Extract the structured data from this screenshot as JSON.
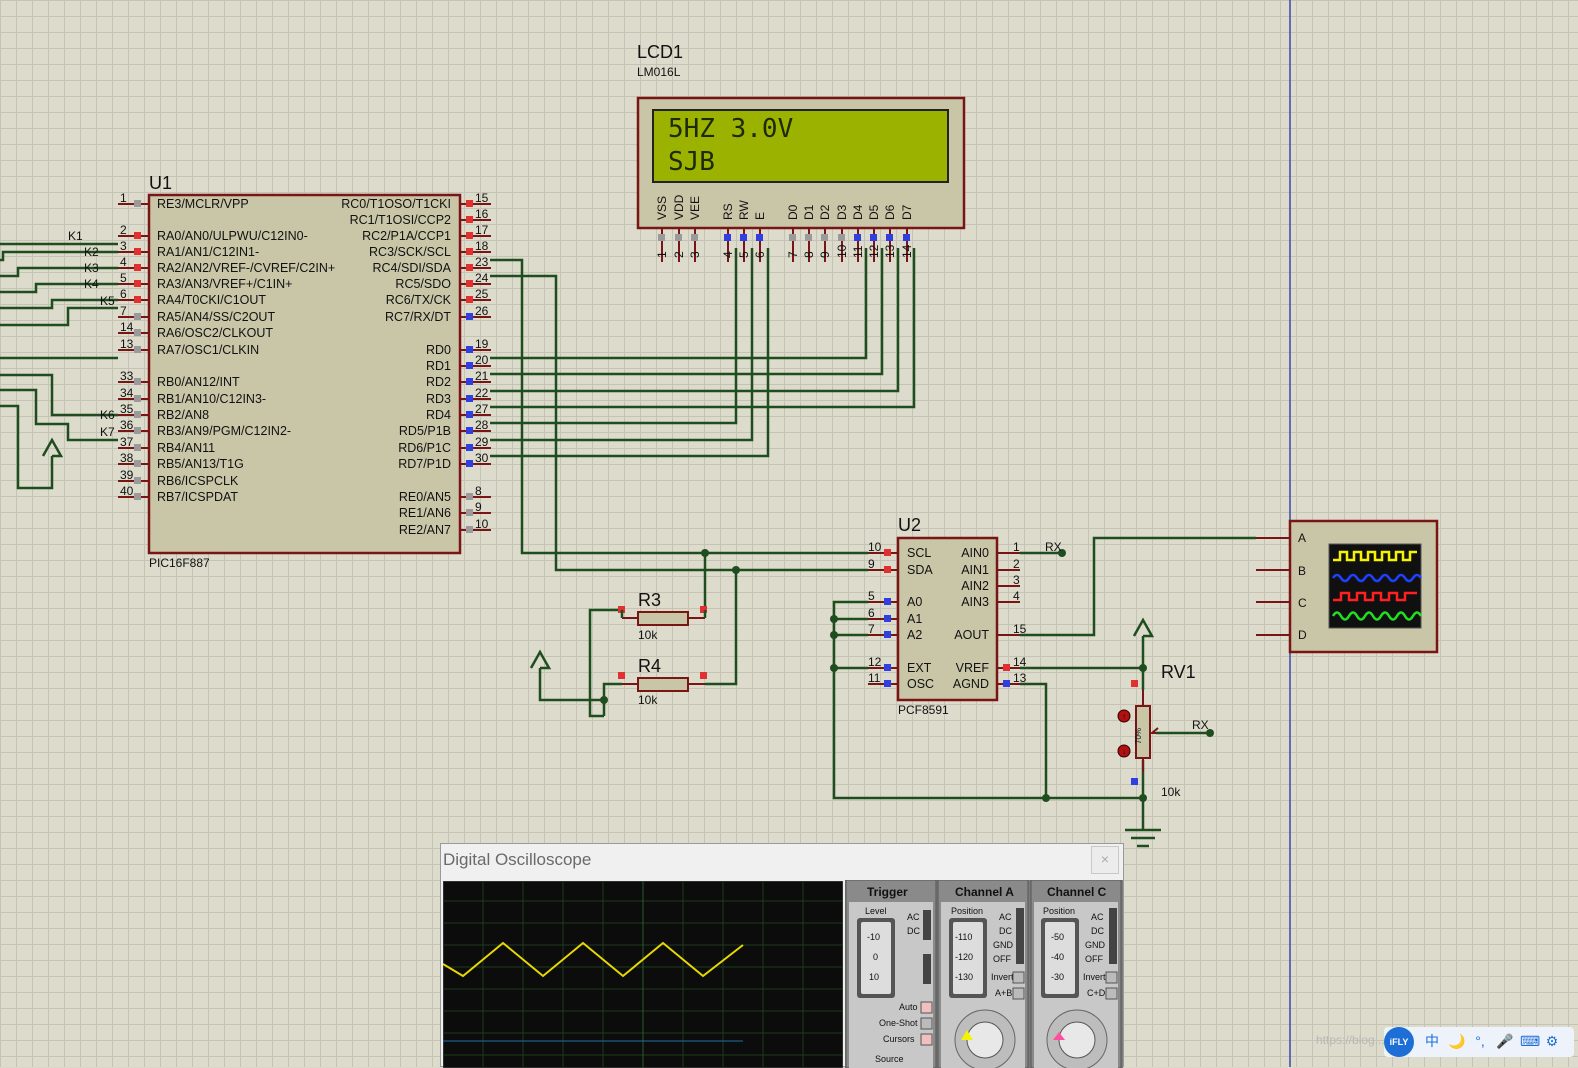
{
  "lcd": {
    "ref": "LCD1",
    "model": "LM016L",
    "line1": "5HZ 3.0V",
    "line2": "SJB",
    "pins": [
      "VSS",
      "VDD",
      "VEE",
      "RS",
      "RW",
      "E",
      "D0",
      "D1",
      "D2",
      "D3",
      "D4",
      "D5",
      "D6",
      "D7"
    ],
    "pin_numbers": [
      "1",
      "2",
      "3",
      "4",
      "5",
      "6",
      "7",
      "8",
      "9",
      "10",
      "11",
      "12",
      "13",
      "14"
    ]
  },
  "u1": {
    "ref": "U1",
    "model": "PIC16F887",
    "left_pins": [
      {
        "num": "1",
        "label": "RE3/MCLR/VPP"
      },
      {
        "num": "2",
        "label": "RA0/AN0/ULPWU/C12IN0-"
      },
      {
        "num": "3",
        "label": "RA1/AN1/C12IN1-"
      },
      {
        "num": "4",
        "label": "RA2/AN2/VREF-/CVREF/C2IN+"
      },
      {
        "num": "5",
        "label": "RA3/AN3/VREF+/C1IN+"
      },
      {
        "num": "6",
        "label": "RA4/T0CKI/C1OUT"
      },
      {
        "num": "7",
        "label": "RA5/AN4/SS/C2OUT"
      },
      {
        "num": "14",
        "label": "RA6/OSC2/CLKOUT"
      },
      {
        "num": "13",
        "label": "RA7/OSC1/CLKIN"
      },
      {
        "num": "33",
        "label": "RB0/AN12/INT"
      },
      {
        "num": "34",
        "label": "RB1/AN10/C12IN3-"
      },
      {
        "num": "35",
        "label": "RB2/AN8"
      },
      {
        "num": "36",
        "label": "RB3/AN9/PGM/C12IN2-"
      },
      {
        "num": "37",
        "label": "RB4/AN11"
      },
      {
        "num": "38",
        "label": "RB5/AN13/T1G"
      },
      {
        "num": "39",
        "label": "RB6/ICSPCLK"
      },
      {
        "num": "40",
        "label": "RB7/ICSPDAT"
      }
    ],
    "right_pins": [
      {
        "num": "15",
        "label": "RC0/T1OSO/T1CKI"
      },
      {
        "num": "16",
        "label": "RC1/T1OSI/CCP2"
      },
      {
        "num": "17",
        "label": "RC2/P1A/CCP1"
      },
      {
        "num": "18",
        "label": "RC3/SCK/SCL"
      },
      {
        "num": "23",
        "label": "RC4/SDI/SDA"
      },
      {
        "num": "24",
        "label": "RC5/SDO"
      },
      {
        "num": "25",
        "label": "RC6/TX/CK"
      },
      {
        "num": "26",
        "label": "RC7/RX/DT"
      },
      {
        "num": "19",
        "label": "RD0"
      },
      {
        "num": "20",
        "label": "RD1"
      },
      {
        "num": "21",
        "label": "RD2"
      },
      {
        "num": "22",
        "label": "RD3"
      },
      {
        "num": "27",
        "label": "RD4"
      },
      {
        "num": "28",
        "label": "RD5/P1B"
      },
      {
        "num": "29",
        "label": "RD6/P1C"
      },
      {
        "num": "30",
        "label": "RD7/P1D"
      },
      {
        "num": "8",
        "label": "RE0/AN5"
      },
      {
        "num": "9",
        "label": "RE1/AN6"
      },
      {
        "num": "10",
        "label": "RE2/AN7"
      }
    ],
    "net_labels": [
      "K1",
      "K2",
      "K3",
      "K4",
      "K5",
      "K6",
      "K7"
    ]
  },
  "u2": {
    "ref": "U2",
    "model": "PCF8591",
    "left_pins": [
      {
        "num": "10",
        "label": "SCL"
      },
      {
        "num": "9",
        "label": "SDA"
      },
      {
        "num": "5",
        "label": "A0"
      },
      {
        "num": "6",
        "label": "A1"
      },
      {
        "num": "7",
        "label": "A2"
      },
      {
        "num": "12",
        "label": "EXT"
      },
      {
        "num": "11",
        "label": "OSC"
      }
    ],
    "right_pins": [
      {
        "num": "1",
        "label": "AIN0"
      },
      {
        "num": "2",
        "label": "AIN1"
      },
      {
        "num": "3",
        "label": "AIN2"
      },
      {
        "num": "4",
        "label": "AIN3"
      },
      {
        "num": "15",
        "label": "AOUT"
      },
      {
        "num": "14",
        "label": "VREF"
      },
      {
        "num": "13",
        "label": "AGND"
      }
    ]
  },
  "r3": {
    "ref": "R3",
    "value": "10k"
  },
  "r4": {
    "ref": "R4",
    "value": "10k"
  },
  "rv1": {
    "ref": "RV1",
    "value": "10k",
    "percent": "70%"
  },
  "rx_labels": [
    "RX",
    "RX"
  ],
  "scope_instrument": {
    "channels": [
      "A",
      "B",
      "C",
      "D"
    ]
  },
  "oscilloscope": {
    "title": "Digital Oscilloscope",
    "close": "×",
    "trigger": {
      "title": "Trigger",
      "level_label": "Level",
      "ticks": [
        "-10",
        "0",
        "10"
      ],
      "coupling": [
        "AC",
        "DC"
      ],
      "modes": [
        "Auto",
        "One-Shot",
        "Cursors"
      ],
      "source_label": "Source"
    },
    "channel_a": {
      "title": "Channel A",
      "position_label": "Position",
      "ticks": [
        "-110",
        "-120",
        "-130"
      ],
      "coupling": [
        "AC",
        "DC",
        "GND",
        "OFF"
      ],
      "invert": "Invert",
      "combine": "A+B"
    },
    "channel_c": {
      "title": "Channel C",
      "position_label": "Position",
      "ticks": [
        "-50",
        "-40",
        "-30"
      ],
      "coupling": [
        "AC",
        "DC",
        "GND",
        "OFF"
      ],
      "invert": "Invert",
      "combine": "C+D"
    },
    "colors": {
      "trigger": "#f08080",
      "channel_a": "#f4f400",
      "channel_c": "#ff4fa0",
      "trace": "#e6d800"
    }
  },
  "taskbar": {
    "badge": "iFLY",
    "icons": [
      "中",
      "🌙",
      "°,",
      "🎤",
      "⌨",
      "⚙"
    ],
    "watermark": "https://blog..."
  }
}
